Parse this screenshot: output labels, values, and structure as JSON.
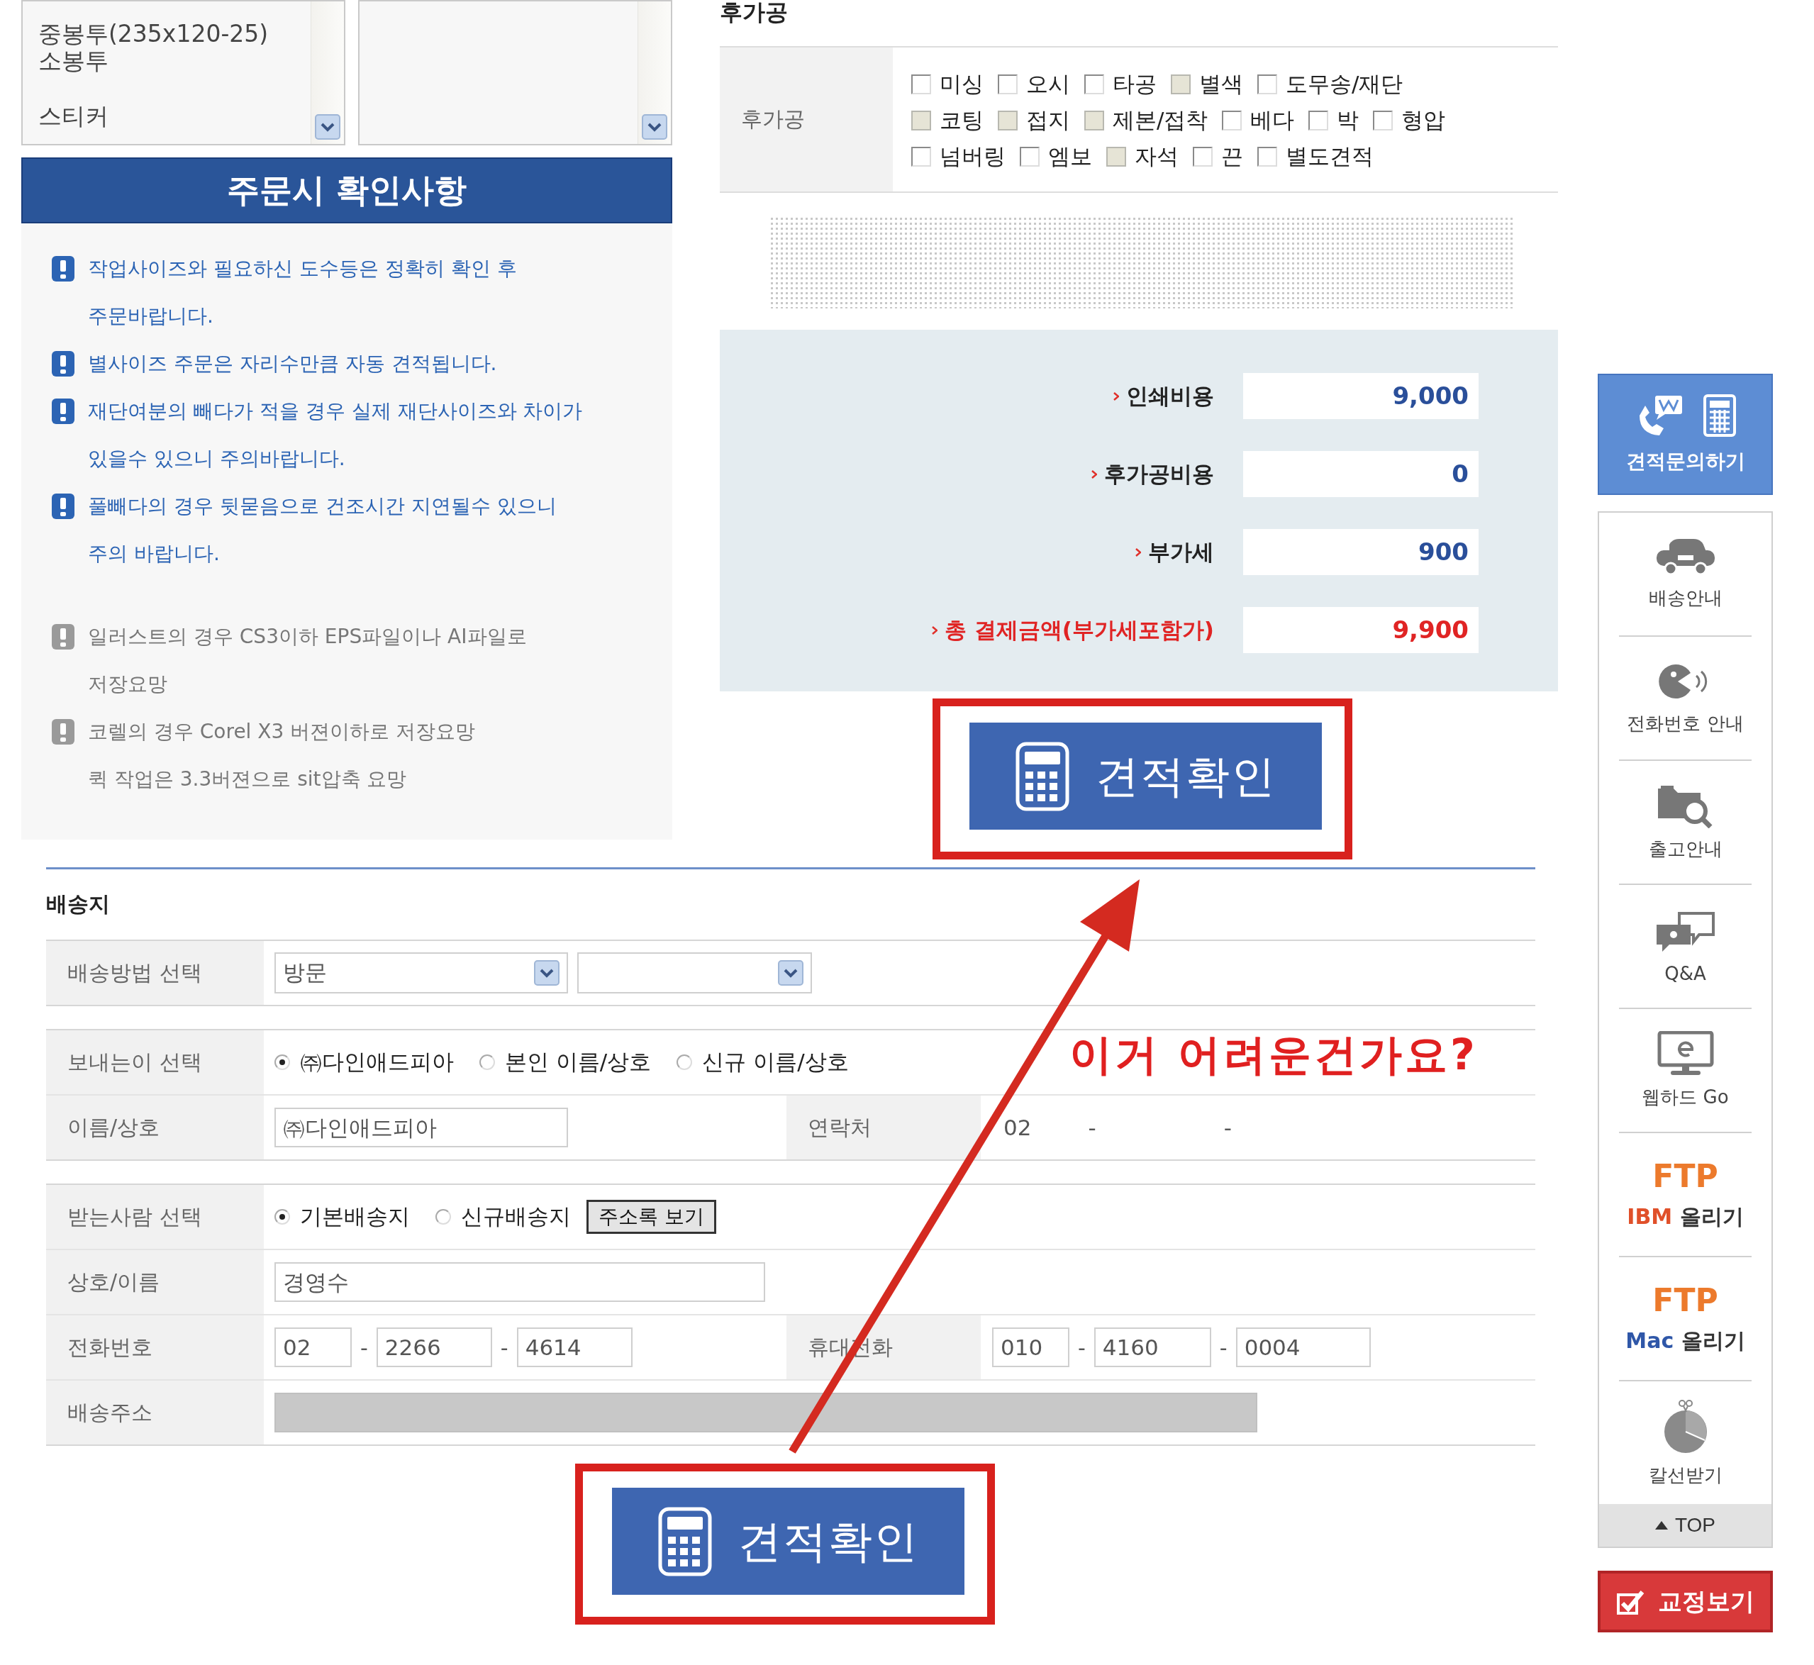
{
  "option_lists": {
    "groups": [
      [
        "중봉투(235x120-25)",
        "소봉투"
      ],
      [
        "스티커"
      ]
    ]
  },
  "notices": {
    "title": "주문시 확인사항",
    "items": [
      {
        "kind": "important",
        "text": "작업사이즈와 필요하신 도수등은 정확히 확인 후\n주문바랍니다."
      },
      {
        "kind": "important",
        "text": "별사이즈 주문은 자리수만큼 자동 견적됩니다."
      },
      {
        "kind": "important",
        "text": "재단여분의 빼다가 적을 경우 실제 재단사이즈와 차이가\n있을수 있으니 주의바랍니다."
      },
      {
        "kind": "important",
        "text": "풀빼다의 경우 뒷묻음으로 건조시간 지연될수 있으니\n주의 바랍니다."
      },
      {
        "kind": "note",
        "text": "일러스트의 경우 CS3이하 EPS파일이나 AI파일로\n저장요망"
      },
      {
        "kind": "note",
        "text": "코렐의 경우 Corel X3 버젼이하로 저장요망\n퀵 작업은 3.3버젼으로 sit압축 요망"
      }
    ]
  },
  "postprocess": {
    "title": "후가공",
    "label": "후가공",
    "option_rows": [
      [
        {
          "label": "미싱",
          "disabled": false
        },
        {
          "label": "오시",
          "disabled": false
        },
        {
          "label": "타공",
          "disabled": false
        },
        {
          "label": "별색",
          "disabled": true
        },
        {
          "label": "도무송/재단",
          "disabled": false
        }
      ],
      [
        {
          "label": "코팅",
          "disabled": true
        },
        {
          "label": "접지",
          "disabled": true
        },
        {
          "label": "제본/접착",
          "disabled": true
        },
        {
          "label": "베다",
          "disabled": false
        },
        {
          "label": "박",
          "disabled": false
        },
        {
          "label": "형압",
          "disabled": false
        }
      ],
      [
        {
          "label": "넘버링",
          "disabled": false
        },
        {
          "label": "엠보",
          "disabled": false
        },
        {
          "label": "자석",
          "disabled": true
        },
        {
          "label": "끈",
          "disabled": false
        },
        {
          "label": "별도견적",
          "disabled": false
        }
      ]
    ]
  },
  "costs": {
    "rows": [
      {
        "kind": "normal",
        "label": "인쇄비용",
        "value": "9,000"
      },
      {
        "kind": "normal",
        "label": "후가공비용",
        "value": "0"
      },
      {
        "kind": "normal",
        "label": "부가세",
        "value": "900"
      },
      {
        "kind": "total",
        "label": "총 결제금액(부가세포함가)",
        "value": "9,900"
      }
    ]
  },
  "quote_buttons": [
    {
      "label": "견적확인"
    },
    {
      "label": "견적확인"
    }
  ],
  "shipping": {
    "title": "배송지",
    "method": {
      "label": "배송방법 선택",
      "value": "방문"
    },
    "sender": {
      "label": "보내는이 선택",
      "options": [
        {
          "label": "㈜다인애드피아",
          "selected": true
        },
        {
          "label": "본인 이름/상호",
          "selected": false
        },
        {
          "label": "신규 이름/상호",
          "selected": false
        }
      ]
    },
    "sender_name": {
      "label": "이름/상호",
      "value": "㈜다인애드피아",
      "contact_label": "연락처",
      "contact": [
        "02",
        "-",
        "-"
      ]
    },
    "receiver": {
      "label": "받는사람 선택",
      "options": [
        {
          "label": "기본배송지",
          "selected": true
        },
        {
          "label": "신규배송지",
          "selected": false
        }
      ],
      "button": "주소록 보기"
    },
    "company": {
      "label": "상호/이름",
      "value": "경영수"
    },
    "phone": {
      "label": "전화번호",
      "parts": [
        "02",
        "2266",
        "4614"
      ],
      "separators": [
        "-",
        "-"
      ],
      "mobile_label": "휴대전화",
      "mobile_parts": [
        "010",
        "4160",
        "0004"
      ],
      "mobile_separators": [
        "-",
        "-"
      ]
    },
    "address": {
      "label": "배송주소",
      "disabled": true
    }
  },
  "annotation": {
    "text": "이거 어려운건가요?"
  },
  "quick_menu": {
    "inquiry": "견적문의하기",
    "items": [
      {
        "kind": "icon",
        "label": "배송안내"
      },
      {
        "kind": "icon",
        "label": "전화번호 안내"
      },
      {
        "kind": "icon",
        "label": "출고안내"
      },
      {
        "kind": "icon",
        "label": "Q&A"
      },
      {
        "kind": "icon",
        "label": "웹하드 Go"
      },
      {
        "kind": "ftp",
        "title": "FTP",
        "brand": "IBM",
        "color": "#e0502a",
        "action": "올리기"
      },
      {
        "kind": "ftp",
        "title": "FTP",
        "brand": "Mac",
        "color": "#2f57a8",
        "action": "올리기"
      },
      {
        "kind": "icon",
        "label": "칼선받기"
      }
    ],
    "top": "TOP",
    "proofread": "교정보기"
  }
}
